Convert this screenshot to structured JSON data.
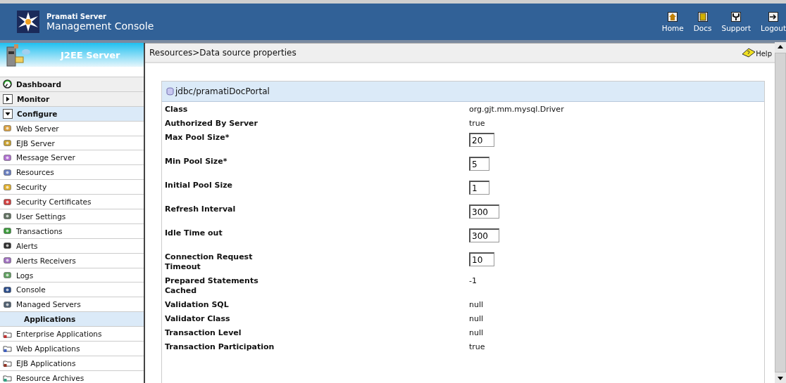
{
  "header": {
    "product": "Pramati Server",
    "title": "Management Console",
    "nav": [
      {
        "label": "Home"
      },
      {
        "label": "Docs"
      },
      {
        "label": "Support"
      },
      {
        "label": "Logout"
      }
    ]
  },
  "sidebar": {
    "title": "J2EE Server",
    "items": [
      {
        "kind": "link",
        "label": "Dashboard"
      },
      {
        "kind": "group",
        "label": "Monitor",
        "expanded": false,
        "selected": false
      },
      {
        "kind": "group",
        "label": "Configure",
        "expanded": true,
        "selected": true
      },
      {
        "kind": "item",
        "label": "Web Server"
      },
      {
        "kind": "item",
        "label": "EJB Server"
      },
      {
        "kind": "item",
        "label": "Message Server"
      },
      {
        "kind": "item",
        "label": "Resources"
      },
      {
        "kind": "item",
        "label": "Security"
      },
      {
        "kind": "item",
        "label": "Security Certificates"
      },
      {
        "kind": "item",
        "label": "User Settings"
      },
      {
        "kind": "item",
        "label": "Transactions"
      },
      {
        "kind": "item",
        "label": "Alerts"
      },
      {
        "kind": "item",
        "label": "Alerts Receivers"
      },
      {
        "kind": "item",
        "label": "Logs"
      },
      {
        "kind": "item",
        "label": "Console"
      },
      {
        "kind": "item",
        "label": "Managed Servers"
      },
      {
        "kind": "section",
        "label": "Applications"
      },
      {
        "kind": "item",
        "label": "Enterprise Applications"
      },
      {
        "kind": "item",
        "label": "Web Applications"
      },
      {
        "kind": "item",
        "label": "EJB Applications"
      },
      {
        "kind": "item",
        "label": "Resource Archives"
      }
    ]
  },
  "breadcrumb": "Resources>Data source properties",
  "help": "Help",
  "panel": {
    "title": "jdbc/pramatiDocPortal",
    "properties": [
      {
        "kind": "text",
        "label": "Class",
        "value": "org.gjt.mm.mysql.Driver"
      },
      {
        "kind": "text",
        "label": "Authorized By Server",
        "value": "true"
      },
      {
        "kind": "input",
        "label": "Max Pool Size*",
        "value": "20"
      },
      {
        "kind": "input",
        "label": "Min Pool Size*",
        "value": "5"
      },
      {
        "kind": "input",
        "label": "Initial Pool Size",
        "value": "1"
      },
      {
        "kind": "input",
        "label": "Refresh Interval",
        "value": "300"
      },
      {
        "kind": "input",
        "label": "Idle Time out",
        "value": "300"
      },
      {
        "kind": "input",
        "label": "Connection Request Timeout",
        "value": "10"
      },
      {
        "kind": "text",
        "label": "Prepared Statements Cached",
        "value": "-1"
      },
      {
        "kind": "text",
        "label": "Validation SQL",
        "value": "null"
      },
      {
        "kind": "text",
        "label": "Validator Class",
        "value": "null"
      },
      {
        "kind": "text",
        "label": "Transaction Level",
        "value": "null"
      },
      {
        "kind": "text",
        "label": "Transaction Participation",
        "value": "true"
      }
    ]
  }
}
